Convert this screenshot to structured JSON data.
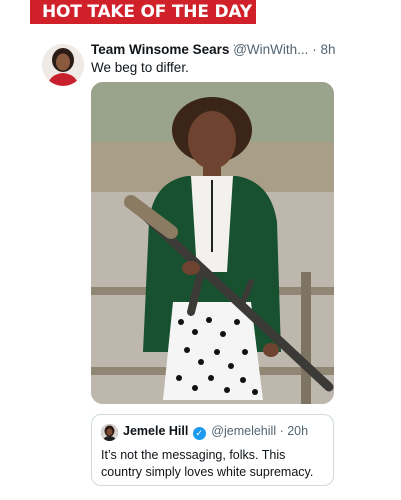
{
  "banner": {
    "title": "HOT TAKE OF THE DAY"
  },
  "tweet": {
    "author_name": "Team Winsome Sears",
    "author_handle": "@WinWith...",
    "separator": "·",
    "time": "8h",
    "more_icon": "ellipsis-icon",
    "text": "We beg to differ.",
    "media_description_icon": "photo"
  },
  "quote": {
    "author_name": "Jemele Hill",
    "verified_icon": "verified-badge-icon",
    "verified_color": "#1d9bf0",
    "author_handle": "@jemelehill",
    "separator": "·",
    "time": "20h",
    "text": "It’s not the messaging, folks. This country simply loves white supremacy."
  },
  "colors": {
    "banner_bg": "#d0202a",
    "secondary_text": "#536471"
  }
}
